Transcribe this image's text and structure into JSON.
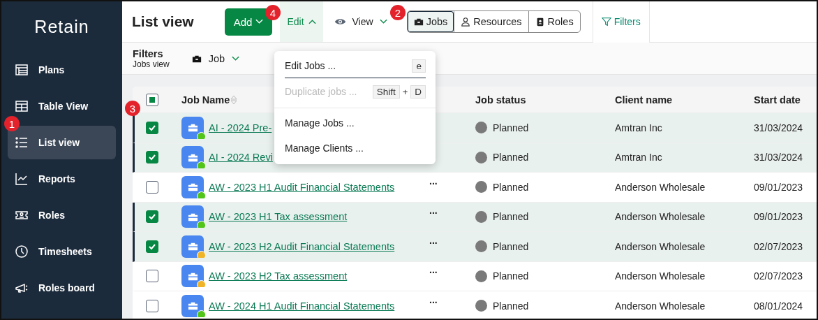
{
  "brand": "Retain",
  "sidebar": {
    "items": [
      {
        "label": "Plans",
        "selected": false
      },
      {
        "label": "Table View",
        "selected": false
      },
      {
        "label": "List view",
        "selected": true
      },
      {
        "label": "Reports",
        "selected": false
      },
      {
        "label": "Roles",
        "selected": false
      },
      {
        "label": "Timesheets",
        "selected": false
      },
      {
        "label": "Roles board",
        "selected": false
      }
    ]
  },
  "page_title": "List view",
  "toolbar": [
    {
      "label": "Add",
      "kind": "primary",
      "expanded": false
    },
    {
      "label": "Edit",
      "kind": "menu",
      "expanded": true
    },
    {
      "label": "View",
      "kind": "view",
      "expanded": false
    }
  ],
  "view_toggle": [
    {
      "label": "Jobs",
      "selected": true
    },
    {
      "label": "Resources",
      "selected": false
    },
    {
      "label": "Roles",
      "selected": false
    }
  ],
  "filters_tab": {
    "label": "Filters",
    "selected": true
  },
  "filter_bar": {
    "title": "Filters",
    "subtitle": "Jobs view",
    "entity": "Job"
  },
  "edit_menu": {
    "items": [
      {
        "label": "Edit Jobs ...",
        "keys": [
          "e"
        ],
        "disabled": false,
        "focused": true
      },
      {
        "label": "Duplicate jobs ...",
        "keys": [
          "Shift",
          "D"
        ],
        "joiner": "+",
        "disabled": true,
        "focused": false
      },
      {
        "label": "Manage Jobs ...",
        "disabled": false,
        "focused": false
      },
      {
        "label": "Manage Clients ...",
        "disabled": false,
        "focused": false
      }
    ]
  },
  "table": {
    "header_checkbox": {
      "indeterminate": true
    },
    "columns": [
      "Job Name",
      "Job status",
      "Client name",
      "Start date"
    ],
    "rows": [
      {
        "checked": true,
        "job_name": "AI - 2024 Pre-",
        "color": "#52c41a",
        "status": "Planned",
        "client": "Amtran Inc",
        "start_date": "31/03/2024"
      },
      {
        "checked": true,
        "job_name": "AI - 2024 Revi",
        "color": "#52c41a",
        "status": "Planned",
        "client": "Amtran Inc",
        "start_date": "31/03/2024"
      },
      {
        "checked": false,
        "job_name": "AW - 2023 H1 Audit Financial Statements",
        "color": "#52c41a",
        "more": "...",
        "status": "Planned",
        "client": "Anderson Wholesale",
        "start_date": "09/01/2023"
      },
      {
        "checked": true,
        "job_name": "AW - 2023 H1 Tax assessment",
        "color": "#52c41a",
        "more": "...",
        "status": "Planned",
        "client": "Anderson Wholesale",
        "start_date": "09/01/2023"
      },
      {
        "checked": true,
        "job_name": "AW - 2023 H2 Audit Financial Statements",
        "color": "#f0b429",
        "more": "...",
        "status": "Planned",
        "client": "Anderson Wholesale",
        "start_date": "02/07/2023"
      },
      {
        "checked": false,
        "job_name": "AW - 2023 H2 Tax assessment",
        "color": "#f0b429",
        "more": "...",
        "status": "Planned",
        "client": "Anderson Wholesale",
        "start_date": "02/07/2023"
      },
      {
        "checked": false,
        "job_name": "AW - 2024 H1 Audit Financial Statements",
        "color": "#52c41a",
        "more": "...",
        "status": "Planned",
        "client": "Anderson Wholesale",
        "start_date": "08/01/2024"
      }
    ]
  },
  "callouts": [
    "1",
    "2",
    "3",
    "4"
  ]
}
